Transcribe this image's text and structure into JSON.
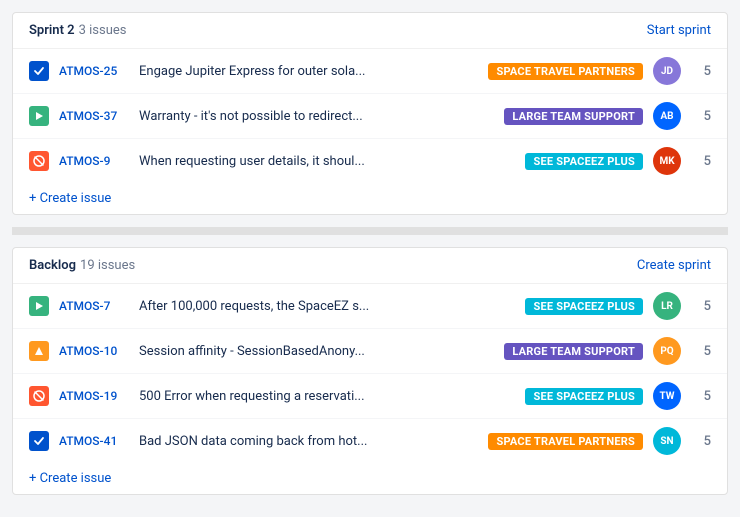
{
  "sprint": {
    "title": "Sprint 2",
    "issue_count_label": "3 issues",
    "action_label": "Start sprint",
    "issues": [
      {
        "id": "ATMOS-25",
        "icon_type": "done",
        "icon_label": "Done",
        "summary": "Engage Jupiter Express for outer sola...",
        "tag_label": "SPACE TRAVEL PARTNERS",
        "tag_class": "tag-orange",
        "avatar_initials": "JD",
        "avatar_class": "avatar-1",
        "points": "5"
      },
      {
        "id": "ATMOS-37",
        "icon_type": "story",
        "icon_label": "Story",
        "summary": "Warranty - it's not possible to redirect...",
        "tag_label": "LARGE TEAM SUPPORT",
        "tag_class": "tag-purple",
        "avatar_initials": "AB",
        "avatar_class": "avatar-2",
        "points": "5"
      },
      {
        "id": "ATMOS-9",
        "icon_type": "bug",
        "icon_label": "Bug",
        "summary": "When requesting user details, it shoul...",
        "tag_label": "SEE SPACEEZ PLUS",
        "tag_class": "tag-cyan",
        "avatar_initials": "MK",
        "avatar_class": "avatar-3",
        "points": "5"
      }
    ],
    "create_issue_label": "+ Create issue"
  },
  "backlog": {
    "title": "Backlog",
    "issue_count_label": "19 issues",
    "action_label": "Create sprint",
    "issues": [
      {
        "id": "ATMOS-7",
        "icon_type": "story",
        "icon_label": "Story",
        "summary": "After 100,000 requests, the SpaceEZ s...",
        "tag_label": "SEE SPACEEZ PLUS",
        "tag_class": "tag-cyan",
        "avatar_initials": "LR",
        "avatar_class": "avatar-4",
        "points": "5"
      },
      {
        "id": "ATMOS-10",
        "icon_type": "improve",
        "icon_label": "Improvement",
        "summary": "Session affinity - SessionBasedAnony...",
        "tag_label": "LARGE TEAM SUPPORT",
        "tag_class": "tag-purple",
        "avatar_initials": "PQ",
        "avatar_class": "avatar-5",
        "points": "5"
      },
      {
        "id": "ATMOS-19",
        "icon_type": "bug",
        "icon_label": "Bug",
        "summary": "500 Error when requesting a reservati...",
        "tag_label": "SEE SPACEEZ PLUS",
        "tag_class": "tag-cyan",
        "avatar_initials": "TW",
        "avatar_class": "avatar-2",
        "points": "5"
      },
      {
        "id": "ATMOS-41",
        "icon_type": "done",
        "icon_label": "Done",
        "summary": "Bad JSON data coming back from hot...",
        "tag_label": "SPACE TRAVEL PARTNERS",
        "tag_class": "tag-orange",
        "avatar_initials": "SN",
        "avatar_class": "avatar-6",
        "points": "5"
      }
    ],
    "create_issue_label": "+ Create issue"
  }
}
